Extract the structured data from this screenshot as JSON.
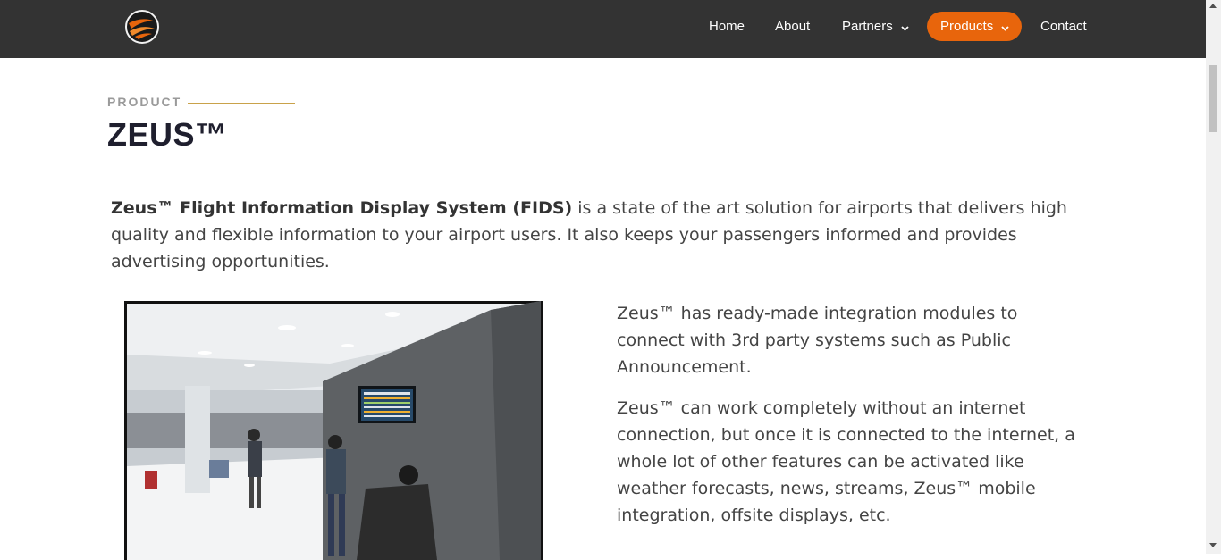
{
  "header": {
    "nav": [
      {
        "label": "Home"
      },
      {
        "label": "About"
      },
      {
        "label": "Partners"
      },
      {
        "label": "Products"
      },
      {
        "label": "Contact"
      }
    ],
    "active_color": "#e8650c",
    "bar_color": "#333333"
  },
  "page": {
    "eyebrow": "PRODUCT",
    "title": "ZEUS™",
    "intro_bold": "Zeus™ Flight Information Display System (FIDS)",
    "intro_rest": " is a state of the art solution for airports that delivers high quality and flexible information to your airport users. It also keeps your passengers informed and provides advertising opportunities.",
    "paragraph_1": "Zeus™ has ready-made integration modules to connect with 3rd party systems such as Public Announcement.",
    "paragraph_2": "Zeus™ can work completely without an internet connection, but once it is connected to the internet, a whole lot of other features can be activated like weather forecasts, news, streams, Zeus™ mobile integration, offsite displays, etc."
  },
  "icons": {
    "logo": "company-logo",
    "dropdown": "chevron-down-icon"
  }
}
